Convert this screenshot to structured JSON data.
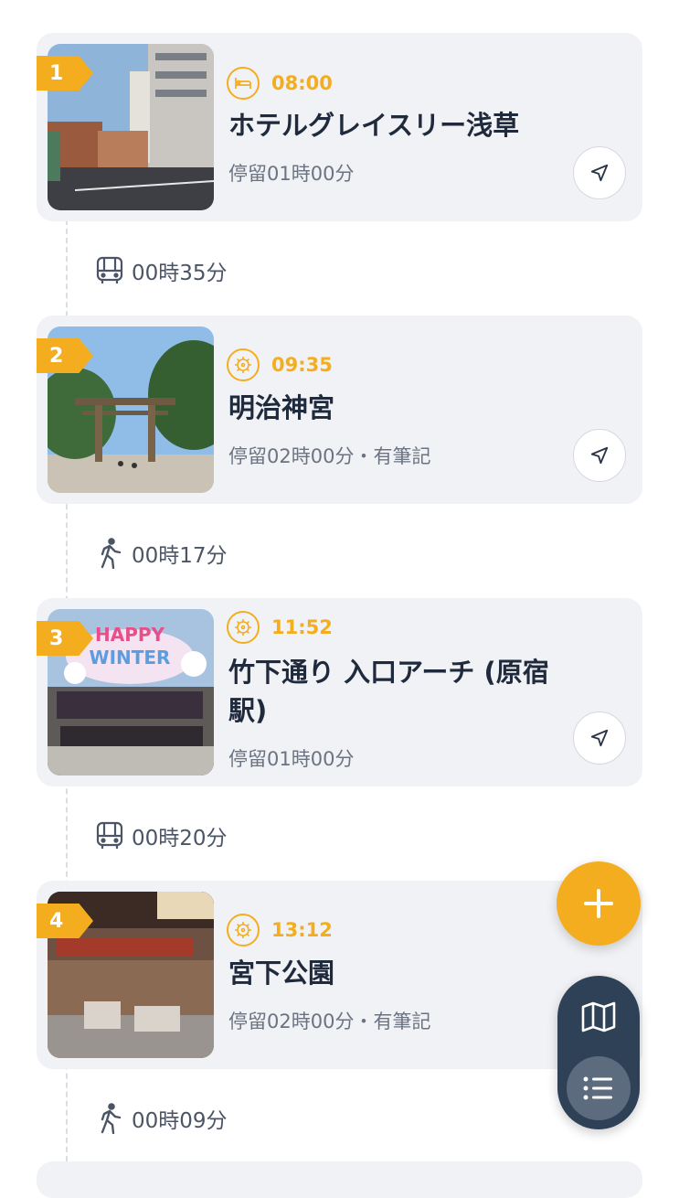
{
  "stops": [
    {
      "number": "1",
      "time": "08:00",
      "category_icon": "hotel-icon",
      "title": "ホテルグレイスリー浅草",
      "stay": "停留01時00分"
    },
    {
      "number": "2",
      "time": "09:35",
      "category_icon": "attraction-icon",
      "title": "明治神宮",
      "stay": "停留02時00分・有筆記"
    },
    {
      "number": "3",
      "time": "11:52",
      "category_icon": "attraction-icon",
      "title": "竹下通り 入口アーチ (原宿駅)",
      "stay": "停留01時00分"
    },
    {
      "number": "4",
      "time": "13:12",
      "category_icon": "attraction-icon",
      "title": "宮下公園",
      "stay": "停留02時00分・有筆記"
    }
  ],
  "transits": [
    {
      "mode_icon": "bus-icon",
      "duration": "00時35分"
    },
    {
      "mode_icon": "walk-icon",
      "duration": "00時17分"
    },
    {
      "mode_icon": "bus-icon",
      "duration": "00時20分"
    },
    {
      "mode_icon": "walk-icon",
      "duration": "00時09分"
    }
  ],
  "colors": {
    "accent": "#f4ad1f",
    "card_bg": "#f1f2f6",
    "toggle_bg": "#2f4157",
    "text_dark": "#1f2a3c",
    "text_muted": "#6b7382"
  },
  "fab": {
    "add_icon": "plus-icon",
    "map_icon": "map-icon",
    "list_icon": "list-icon"
  }
}
